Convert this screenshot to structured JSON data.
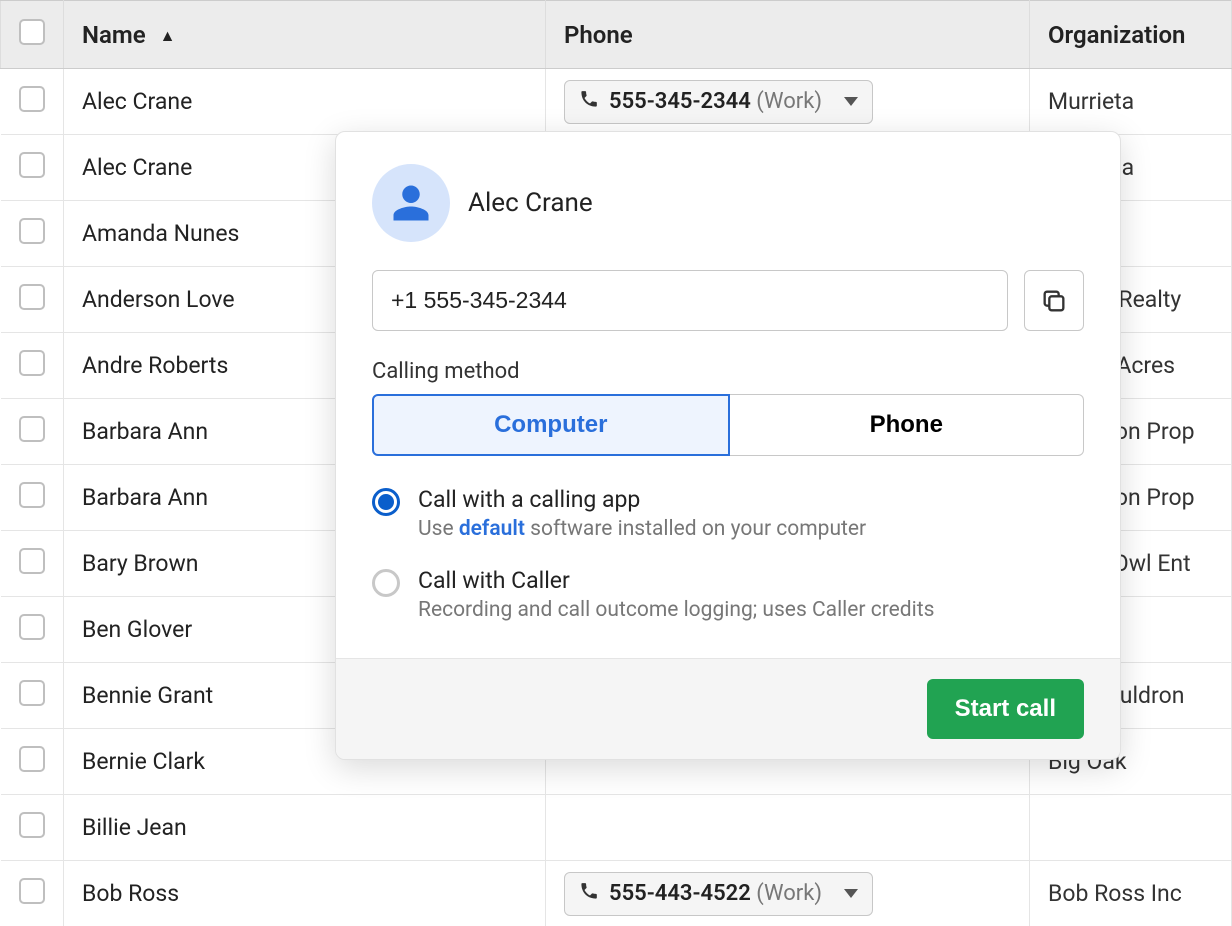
{
  "columns": {
    "name": "Name",
    "phone": "Phone",
    "organization": "Organization"
  },
  "rows": [
    {
      "name": "Alec Crane",
      "phone_number": "555-345-2344",
      "phone_type": "(Work)",
      "organization": "Murrieta"
    },
    {
      "name": "Alec Crane",
      "phone_number": "",
      "phone_type": "",
      "organization": "Murrieta"
    },
    {
      "name": "Amanda Nunes",
      "phone_number": "",
      "phone_type": "",
      "organization": ""
    },
    {
      "name": "Anderson Love",
      "phone_number": "",
      "phone_type": "",
      "organization": "Estate Realty"
    },
    {
      "name": "Andre Roberts",
      "phone_number": "",
      "phone_type": "",
      "organization": "Sunny Acres"
    },
    {
      "name": "Barbara Ann",
      "phone_number": "",
      "phone_type": "",
      "organization": "Arlington Prop"
    },
    {
      "name": "Barbara Ann",
      "phone_number": "",
      "phone_type": "",
      "organization": "Arlington Prop"
    },
    {
      "name": "Bary Brown",
      "phone_number": "",
      "phone_type": "",
      "organization": "Barns Owl Ent"
    },
    {
      "name": "Ben Glover",
      "phone_number": "",
      "phone_type": "",
      "organization": ""
    },
    {
      "name": "Bennie Grant",
      "phone_number": "",
      "phone_type": "",
      "organization": "The Cauldron"
    },
    {
      "name": "Bernie Clark",
      "phone_number": "",
      "phone_type": "",
      "organization": "Big Oak"
    },
    {
      "name": "Billie Jean",
      "phone_number": "",
      "phone_type": "",
      "organization": ""
    },
    {
      "name": "Bob Ross",
      "phone_number": "555-443-4522",
      "phone_type": "(Work)",
      "organization": "Bob Ross Inc"
    }
  ],
  "popover": {
    "contact_name": "Alec Crane",
    "phone_value": "+1 555-345-2344",
    "calling_method_label": "Calling method",
    "tab_computer": "Computer",
    "tab_phone": "Phone",
    "option_app_title": "Call with a calling app",
    "option_app_desc_pre": "Use ",
    "option_app_desc_link": "default",
    "option_app_desc_post": " software installed on your computer",
    "option_caller_title": "Call with Caller",
    "option_caller_desc": "Recording and call outcome logging; uses Caller credits",
    "start_call": "Start call"
  }
}
